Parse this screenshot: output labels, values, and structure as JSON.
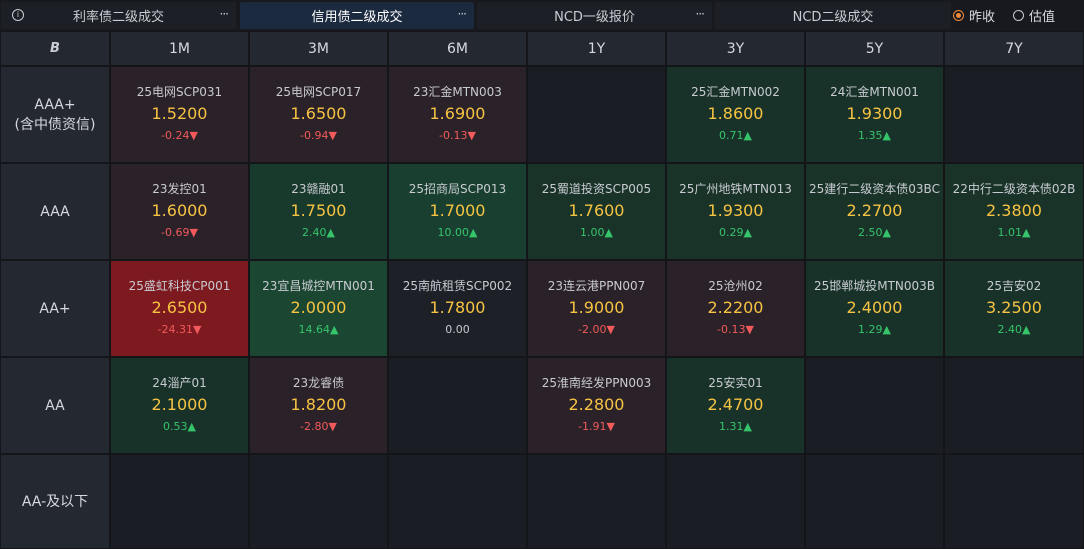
{
  "tabs": [
    {
      "label": "利率债二级成交",
      "active": false
    },
    {
      "label": "信用债二级成交",
      "active": true
    },
    {
      "label": "NCD一级报价",
      "active": false
    },
    {
      "label": "NCD二级成交",
      "active": false
    }
  ],
  "radio": {
    "option1": "昨收",
    "option2": "估值",
    "selected": "昨收"
  },
  "table": {
    "corner_logo": "B",
    "columns": [
      "1M",
      "3M",
      "6M",
      "1Y",
      "3Y",
      "5Y",
      "7Y"
    ],
    "rows": [
      {
        "label": "AAA+\n(含中债资信)"
      },
      {
        "label": "AAA"
      },
      {
        "label": "AA+"
      },
      {
        "label": "AA"
      },
      {
        "label": "AA-及以下"
      }
    ],
    "cells": [
      [
        {
          "name": "25电网SCP031",
          "yield": "1.5200",
          "change": "-0.24▼",
          "dir": "down"
        },
        {
          "name": "25电网SCP017",
          "yield": "1.6500",
          "change": "-0.94▼",
          "dir": "down"
        },
        {
          "name": "23汇金MTN003",
          "yield": "1.6900",
          "change": "-0.13▼",
          "dir": "down"
        },
        null,
        {
          "name": "25汇金MTN002",
          "yield": "1.8600",
          "change": "0.71▲",
          "dir": "up"
        },
        {
          "name": "24汇金MTN001",
          "yield": "1.9300",
          "change": "1.35▲",
          "dir": "up"
        },
        null
      ],
      [
        {
          "name": "23发控01",
          "yield": "1.6000",
          "change": "-0.69▼",
          "dir": "down"
        },
        {
          "name": "23赣融01",
          "yield": "1.7500",
          "change": "2.40▲",
          "dir": "up"
        },
        {
          "name": "25招商局SCP013",
          "yield": "1.7000",
          "change": "10.00▲",
          "dir": "up"
        },
        {
          "name": "25蜀道投资SCP005",
          "yield": "1.7600",
          "change": "1.00▲",
          "dir": "up"
        },
        {
          "name": "25广州地铁MTN013",
          "yield": "1.9300",
          "change": "0.29▲",
          "dir": "up"
        },
        {
          "name": "25建行二级资本债03BC",
          "yield": "2.2700",
          "change": "2.50▲",
          "dir": "up"
        },
        {
          "name": "22中行二级资本债02B",
          "yield": "2.3800",
          "change": "1.01▲",
          "dir": "up"
        }
      ],
      [
        {
          "name": "25盛虹科技CP001",
          "yield": "2.6500",
          "change": "-24.31▼",
          "dir": "down"
        },
        {
          "name": "23宜昌城控MTN001",
          "yield": "2.0000",
          "change": "14.64▲",
          "dir": "up"
        },
        {
          "name": "25南航租赁SCP002",
          "yield": "1.7800",
          "change": "0.00",
          "dir": "flat"
        },
        {
          "name": "23连云港PPN007",
          "yield": "1.9000",
          "change": "-2.00▼",
          "dir": "down"
        },
        {
          "name": "25沧州02",
          "yield": "2.2200",
          "change": "-0.13▼",
          "dir": "down"
        },
        {
          "name": "25邯郸城投MTN003B",
          "yield": "2.4000",
          "change": "1.29▲",
          "dir": "up"
        },
        {
          "name": "25吉安02",
          "yield": "3.2500",
          "change": "2.40▲",
          "dir": "up"
        }
      ],
      [
        {
          "name": "24淄产01",
          "yield": "2.1000",
          "change": "0.53▲",
          "dir": "up"
        },
        {
          "name": "23龙睿债",
          "yield": "1.8200",
          "change": "-2.80▼",
          "dir": "down"
        },
        null,
        {
          "name": "25淮南经发PPN003",
          "yield": "2.2800",
          "change": "-1.91▼",
          "dir": "down"
        },
        {
          "name": "25安实01",
          "yield": "2.4700",
          "change": "1.31▲",
          "dir": "up"
        },
        null,
        null
      ],
      [
        null,
        null,
        null,
        null,
        null,
        null,
        null
      ]
    ],
    "cell_backgrounds": [
      [
        "#2b2128",
        "#2b2128",
        "#2b2128",
        null,
        "#183229",
        "#183229",
        null
      ],
      [
        "#2b2128",
        "#183a2d",
        "#183f30",
        "#1a3329",
        "#1a3329",
        "#1a3329",
        "#1a3329"
      ],
      [
        "#7c1a20",
        "#1b4632",
        "#1d2026",
        "#2b2128",
        "#2b2128",
        "#183229",
        "#183229"
      ],
      [
        "#183229",
        "#2b2128",
        null,
        "#2b2128",
        "#183229",
        null,
        null
      ],
      [
        null,
        null,
        null,
        null,
        null,
        null,
        null
      ]
    ]
  },
  "colors": {
    "yield": "#f6c343",
    "up": "#36c46b",
    "down": "#f05a5a",
    "accent": "#f08a3a"
  }
}
